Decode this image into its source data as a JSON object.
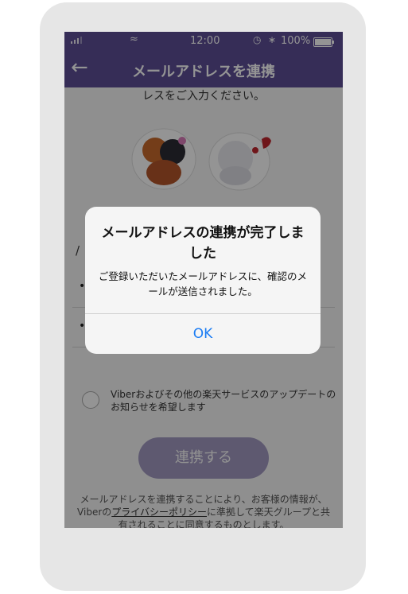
{
  "statusbar": {
    "time": "12:00",
    "battery": "100%",
    "wifi_icon": "wifi-icon",
    "alarm_icon": "alarm-icon",
    "bluetooth_icon": "bluetooth-icon"
  },
  "navbar": {
    "back_icon": "back-arrow-icon",
    "title": "メールアドレスを連携"
  },
  "intro": "レスをご入力ください。",
  "stickers": [
    "cat-hug-sticker",
    "cat-kiss-sticker"
  ],
  "form": {
    "email_value": "•",
    "confirm_value": "•",
    "optin_text": "Viberおよびその他の楽天サービスのアップデートのお知らせを希望します",
    "submit_label": "連携する"
  },
  "terms": {
    "before": "メールアドレスを連携することにより、お客様の情報が、Viberの",
    "link": "プライバシーポリシー",
    "after": "に準拠して楽天グループと共有されることに同意するものとします。"
  },
  "dialog": {
    "title": "メールアドレスの連携が完了しました",
    "message": "ご登録いただいたメールアドレスに、確認のメールが送信されました。",
    "ok_label": "OK"
  },
  "colors": {
    "brand": "#5d4e97",
    "ok": "#1a7cf4"
  }
}
